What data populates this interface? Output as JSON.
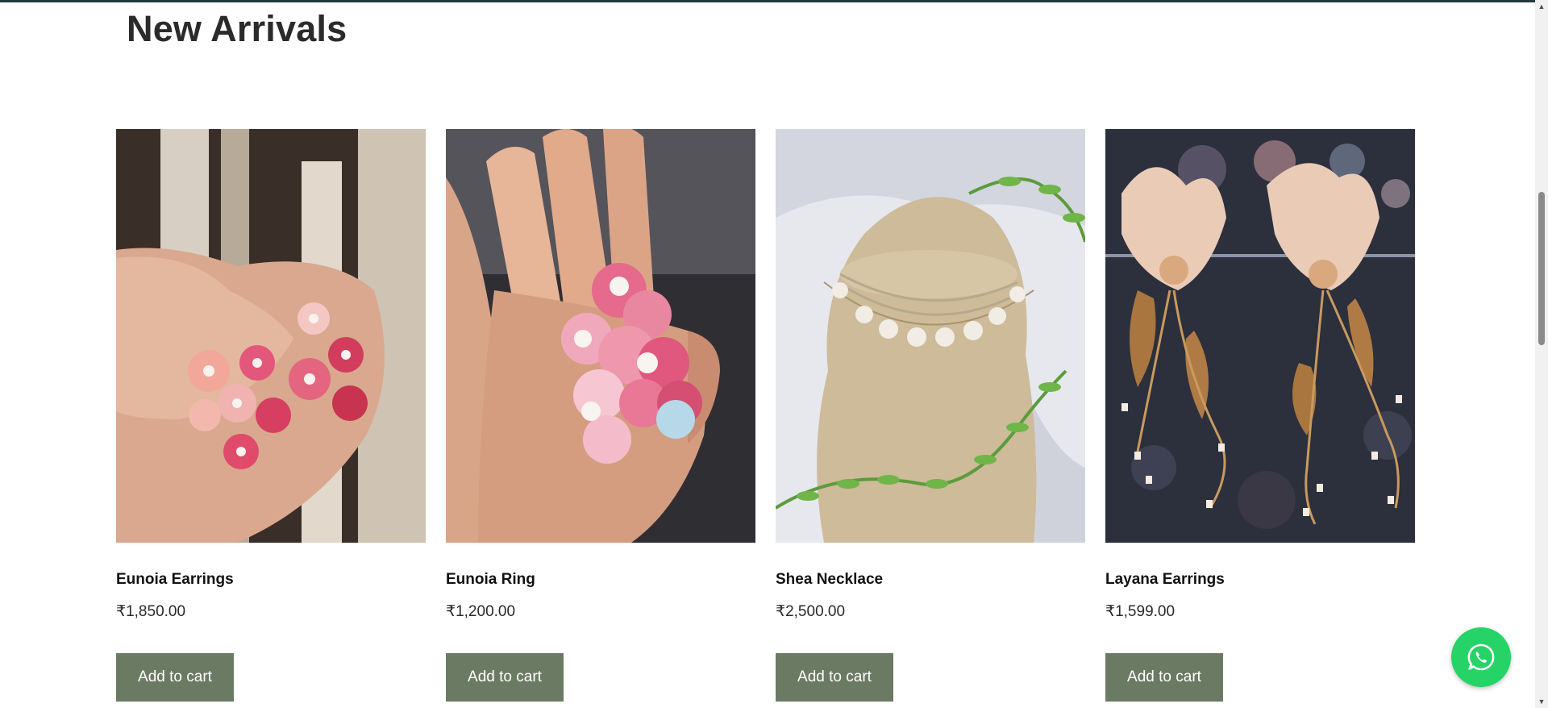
{
  "section": {
    "title": "New Arrivals"
  },
  "products": [
    {
      "name": "Eunoia Earrings",
      "price": "₹1,850.00",
      "button_label": "Add to cart",
      "image_icon": "pink-flower-earrings-image"
    },
    {
      "name": "Eunoia Ring",
      "price": "₹1,200.00",
      "button_label": "Add to cart",
      "image_icon": "pink-flower-ring-image"
    },
    {
      "name": "Shea Necklace",
      "price": "₹2,500.00",
      "button_label": "Add to cart",
      "image_icon": "necklace-on-bust-image"
    },
    {
      "name": "Layana Earrings",
      "price": "₹1,599.00",
      "button_label": "Add to cart",
      "image_icon": "beaded-gold-earrings-image"
    }
  ],
  "colors": {
    "button_bg": "#6b7b63",
    "button_text": "#ffffff",
    "whatsapp_green": "#25d366",
    "top_border": "#24383a"
  },
  "floating": {
    "whatsapp_icon": "whatsapp-icon"
  }
}
